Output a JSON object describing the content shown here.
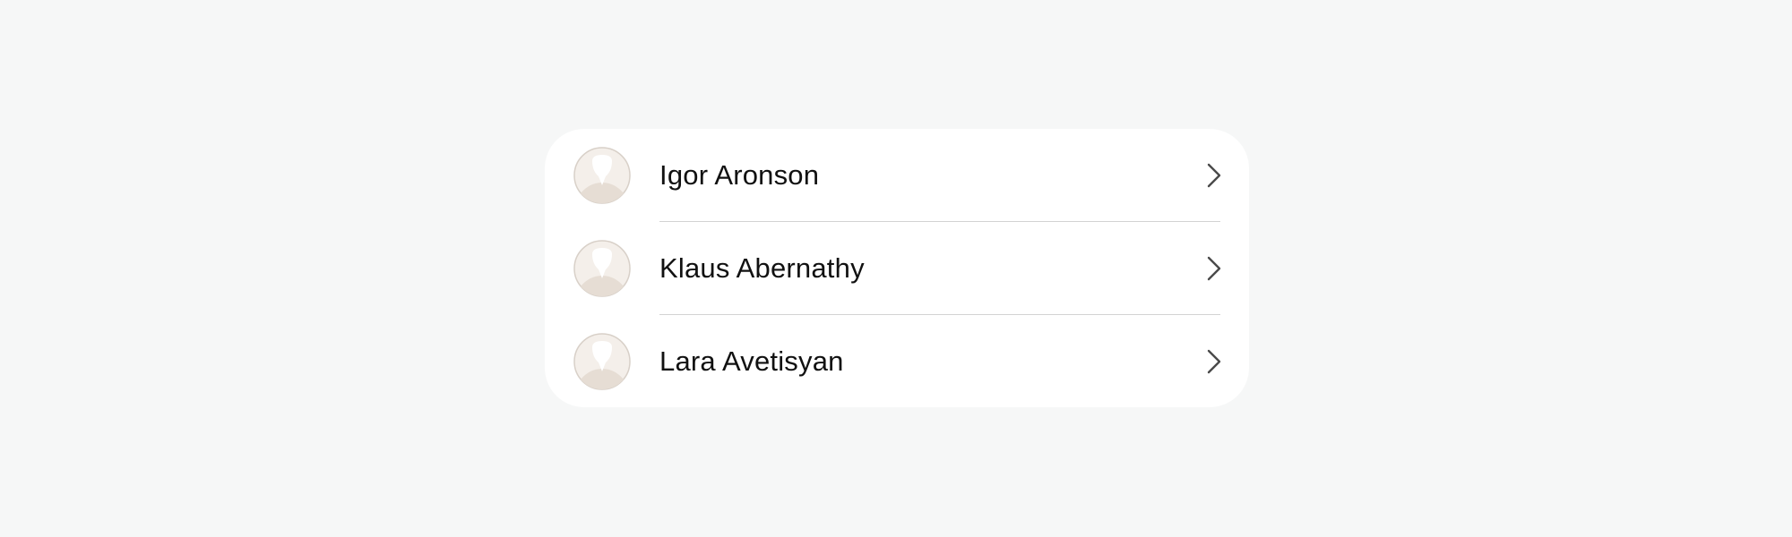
{
  "contacts": [
    {
      "name": "Igor Aronson",
      "avatar_icon": "person-placeholder-icon",
      "chevron_icon": "chevron-right-icon"
    },
    {
      "name": "Klaus Abernathy",
      "avatar_icon": "person-placeholder-icon",
      "chevron_icon": "chevron-right-icon"
    },
    {
      "name": "Lara Avetisyan",
      "avatar_icon": "person-placeholder-icon",
      "chevron_icon": "chevron-right-icon"
    }
  ],
  "colors": {
    "background": "#f6f7f7",
    "card": "#ffffff",
    "text": "#111111",
    "divider": "#d3d3d3",
    "chevron": "#4a4a4a",
    "avatar_fill": "#f4efea",
    "avatar_border": "#d8d0c8"
  }
}
